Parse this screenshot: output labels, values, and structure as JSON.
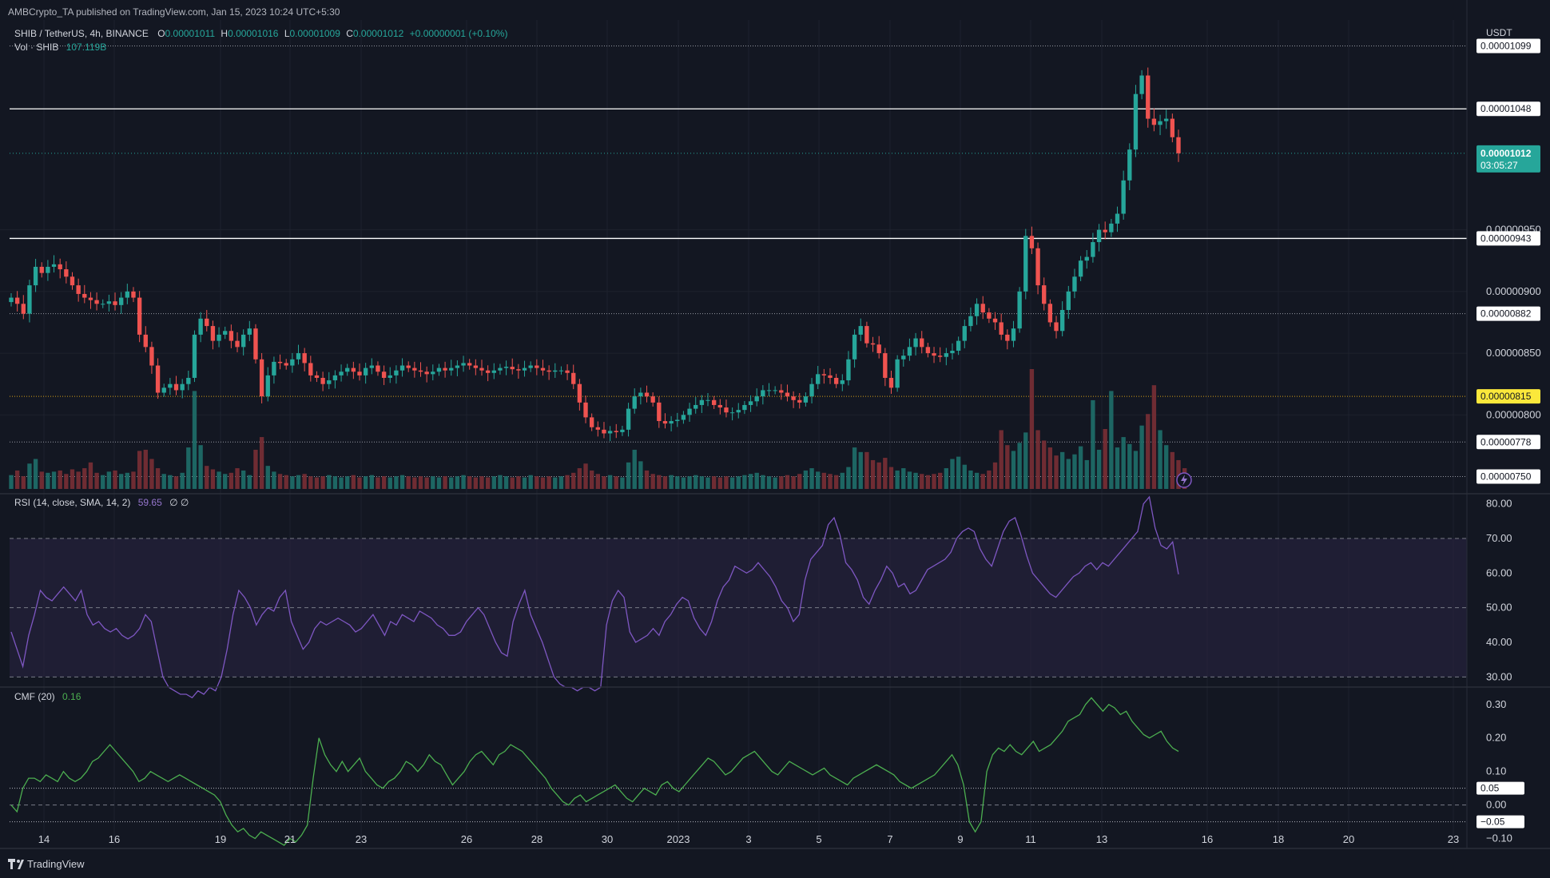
{
  "header": {
    "publisher": "AMBCrypto_TA published on TradingView.com, Jan 15, 2023 10:24 UTC+5:30"
  },
  "footer": {
    "brand": "TradingView"
  },
  "colors": {
    "background": "#131722",
    "up": "#26a69a",
    "down": "#ef5350",
    "volume_up": "#1f6f6a",
    "volume_down": "#7a2f35",
    "rsi_line": "#7e57c2",
    "rsi_band": "#2a2443",
    "cmf_line": "#4caf50",
    "price_tag": "#26a69a",
    "level_highlight": "#fbe83b"
  },
  "chart_data": [
    {
      "type": "candlestick",
      "legend": {
        "symbol": "SHIB / TetherUS, 4h, BINANCE",
        "o_label": "O",
        "o_value": "0.00001011",
        "h_label": "H",
        "h_value": "0.00001016",
        "l_label": "L",
        "l_value": "0.00001009",
        "c_label": "C",
        "c_value": "0.00001012",
        "change": "+0.00000001 (+0.10%)",
        "volume_label": "Vol · SHIB",
        "volume_value": "107.119B"
      },
      "currency": "USDT",
      "ylim": [
        7.4e-06,
        1.12e-05
      ],
      "y_ticks": [
        "0.00000950",
        "0.00000900",
        "0.00000850",
        "0.00000800"
      ],
      "y_tick_values": [
        9.5e-06,
        9e-06,
        8.5e-06,
        8e-06
      ],
      "x_ticks": [
        "14",
        "16",
        "19",
        "21",
        "23",
        "26",
        "28",
        "30",
        "2023",
        "3",
        "5",
        "7",
        "9",
        "11",
        "13",
        "16",
        "18",
        "20",
        "23"
      ],
      "levels": [
        {
          "label": "0.00001099",
          "value": 1.099e-05,
          "style": "dotted",
          "highlight": false
        },
        {
          "label": "0.00001048",
          "value": 1.048e-05,
          "style": "solid",
          "highlight": false
        },
        {
          "label": "0.00000943",
          "value": 9.43e-06,
          "style": "solid",
          "highlight": false
        },
        {
          "label": "0.00000882",
          "value": 8.82e-06,
          "style": "dotted",
          "highlight": false
        },
        {
          "label": "0.00000815",
          "value": 8.15e-06,
          "style": "dotted",
          "highlight": true
        },
        {
          "label": "0.00000778",
          "value": 7.78e-06,
          "style": "dotted",
          "highlight": false
        },
        {
          "label": "0.00000750",
          "value": 7.5e-06,
          "style": "dotted",
          "highlight": false
        }
      ],
      "current_price": {
        "label": "0.00001012",
        "countdown": "03:05:27",
        "value": 1.012e-05
      },
      "closes": [
        8.95e-06,
        8.9e-06,
        8.82e-06,
        9.05e-06,
        9.2e-06,
        9.15e-06,
        9.2e-06,
        9.22e-06,
        9.18e-06,
        9.12e-06,
        9.05e-06,
        8.98e-06,
        8.95e-06,
        8.93e-06,
        8.9e-06,
        8.9e-06,
        8.92e-06,
        8.89e-06,
        8.95e-06,
        9e-06,
        8.95e-06,
        8.65e-06,
        8.55e-06,
        8.4e-06,
        8.18e-06,
        8.22e-06,
        8.25e-06,
        8.2e-06,
        8.25e-06,
        8.3e-06,
        8.65e-06,
        8.78e-06,
        8.72e-06,
        8.6e-06,
        8.65e-06,
        8.68e-06,
        8.6e-06,
        8.55e-06,
        8.65e-06,
        8.7e-06,
        8.45e-06,
        8.15e-06,
        8.32e-06,
        8.43e-06,
        8.42e-06,
        8.4e-06,
        8.45e-06,
        8.5e-06,
        8.42e-06,
        8.32e-06,
        8.3e-06,
        8.25e-06,
        8.28e-06,
        8.32e-06,
        8.35e-06,
        8.38e-06,
        8.35e-06,
        8.32e-06,
        8.38e-06,
        8.4e-06,
        8.35e-06,
        8.3e-06,
        8.32e-06,
        8.36e-06,
        8.4e-06,
        8.38e-06,
        8.36e-06,
        8.35e-06,
        8.33e-06,
        8.35e-06,
        8.38e-06,
        8.36e-06,
        8.38e-06,
        8.4e-06,
        8.42e-06,
        8.4e-06,
        8.38e-06,
        8.36e-06,
        8.34e-06,
        8.36e-06,
        8.38e-06,
        8.39e-06,
        8.37e-06,
        8.36e-06,
        8.38e-06,
        8.4e-06,
        8.38e-06,
        8.36e-06,
        8.35e-06,
        8.36e-06,
        8.36e-06,
        8.34e-06,
        8.25e-06,
        8.1e-06,
        7.98e-06,
        7.9e-06,
        7.88e-06,
        7.85e-06,
        7.87e-06,
        7.86e-06,
        7.88e-06,
        8.05e-06,
        8.15e-06,
        8.18e-06,
        8.15e-06,
        8.1e-06,
        7.95e-06,
        7.93e-06,
        7.95e-06,
        7.96e-06,
        8e-06,
        8.05e-06,
        8.08e-06,
        8.12e-06,
        8.12e-06,
        8.08e-06,
        8.06e-06,
        8.02e-06,
        8.02e-06,
        8.04e-06,
        8.08e-06,
        8.11e-06,
        8.15e-06,
        8.2e-06,
        8.2e-06,
        8.2e-06,
        8.18e-06,
        8.15e-06,
        8.12e-06,
        8.1e-06,
        8.15e-06,
        8.25e-06,
        8.33e-06,
        8.32e-06,
        8.3e-06,
        8.25e-06,
        8.28e-06,
        8.45e-06,
        8.65e-06,
        8.72e-06,
        8.58e-06,
        8.57e-06,
        8.5e-06,
        8.3e-06,
        8.22e-06,
        8.45e-06,
        8.48e-06,
        8.55e-06,
        8.62e-06,
        8.55e-06,
        8.5e-06,
        8.48e-06,
        8.47e-06,
        8.5e-06,
        8.52e-06,
        8.6e-06,
        8.72e-06,
        8.8e-06,
        8.9e-06,
        8.83e-06,
        8.78e-06,
        8.75e-06,
        8.65e-06,
        8.6e-06,
        8.7e-06,
        9e-06,
        9.45e-06,
        9.35e-06,
        9.05e-06,
        8.9e-06,
        8.75e-06,
        8.68e-06,
        8.85e-06,
        9e-06,
        9.12e-06,
        9.25e-06,
        9.28e-06,
        9.4e-06,
        9.5e-06,
        9.48e-06,
        9.55e-06,
        9.63e-06,
        9.9e-06,
        1.015e-05,
        1.06e-05,
        1.075e-05,
        1.04e-05,
        1.035e-05,
        1.038e-05,
        1.04e-05,
        1.025e-05,
        1.012e-05
      ],
      "vol_values": [
        1.2,
        1.6,
        1.1,
        2.2,
        2.6,
        1.5,
        1.4,
        1.5,
        1.6,
        1.3,
        1.7,
        1.5,
        1.8,
        2.3,
        1.4,
        1.2,
        1.5,
        1.6,
        1.3,
        1.4,
        1.5,
        3.3,
        3.4,
        2.6,
        1.8,
        1.3,
        1.2,
        1.1,
        1.4,
        3.6,
        8.5,
        3.8,
        2.0,
        1.7,
        1.5,
        1.3,
        1.4,
        1.8,
        1.6,
        1.2,
        3.4,
        4.5,
        2.0,
        1.5,
        1.3,
        1.2,
        1.1,
        1.2,
        1.3,
        1.1,
        1.0,
        1.1,
        1.2,
        1.1,
        1.0,
        1.1,
        1.2,
        1.0,
        1.1,
        1.2,
        1.0,
        1.1,
        1.0,
        1.1,
        1.2,
        1.1,
        1.0,
        1.1,
        1.0,
        1.1,
        1.0,
        1.1,
        1.0,
        1.1,
        1.2,
        1.1,
        1.0,
        1.1,
        1.0,
        1.1,
        1.2,
        1.1,
        1.0,
        1.1,
        1.0,
        1.2,
        1.1,
        1.0,
        1.1,
        1.0,
        1.1,
        1.2,
        1.4,
        1.8,
        2.2,
        1.6,
        1.3,
        1.1,
        1.2,
        1.1,
        1.0,
        2.3,
        3.4,
        2.4,
        1.6,
        1.3,
        1.2,
        1.1,
        1.2,
        1.1,
        1.0,
        1.1,
        1.2,
        1.1,
        1.0,
        1.1,
        1.0,
        1.1,
        1.0,
        1.1,
        1.2,
        1.3,
        1.4,
        1.2,
        1.1,
        1.0,
        1.1,
        1.2,
        1.1,
        1.3,
        1.6,
        1.8,
        1.5,
        1.4,
        1.3,
        1.2,
        1.4,
        1.9,
        3.6,
        3.2,
        3.2,
        2.5,
        2.3,
        2.7,
        1.9,
        1.6,
        1.8,
        1.5,
        1.4,
        1.3,
        1.2,
        1.3,
        1.4,
        1.8,
        2.6,
        2.8,
        2.1,
        1.6,
        1.4,
        1.3,
        1.6,
        2.3,
        5.1,
        3.8,
        3.3,
        4.0,
        4.9,
        10.4,
        5.1,
        4.2,
        3.6,
        2.9,
        3.2,
        2.6,
        3.0,
        3.7,
        2.5,
        7.7,
        3.4,
        5.2,
        8.5,
        3.6,
        4.5,
        3.9,
        3.3,
        5.5,
        6.5,
        9.0,
        5.1,
        3.8,
        3.2,
        2.5,
        1.8
      ]
    },
    {
      "type": "line",
      "legend": {
        "name": "RSI (14, close, SMA, 14, 2)",
        "value": "59.65",
        "extra": "∅ ∅"
      },
      "ylim": [
        28,
        82
      ],
      "y_ticks": [
        "80.00",
        "70.00",
        "60.00",
        "50.00",
        "40.00",
        "30.00"
      ],
      "y_tick_values": [
        80,
        70,
        60,
        50,
        40,
        30
      ],
      "band": [
        30,
        70
      ],
      "midline": 50,
      "values": [
        43,
        38,
        33,
        42,
        48,
        55,
        53,
        52,
        54,
        56,
        54,
        52,
        55,
        48,
        45,
        46,
        44,
        43,
        44,
        42,
        41,
        42,
        44,
        48,
        46,
        38,
        30,
        27,
        26,
        25,
        25,
        24,
        26,
        25,
        27,
        26,
        30,
        38,
        48,
        55,
        53,
        50,
        45,
        48,
        50,
        49,
        53,
        55,
        46,
        42,
        38,
        40,
        44,
        46,
        45,
        46,
        47,
        46,
        45,
        43,
        44,
        46,
        48,
        45,
        42,
        46,
        45,
        48,
        47,
        46,
        49,
        48,
        47,
        45,
        44,
        42,
        42,
        43,
        46,
        48,
        50,
        48,
        44,
        40,
        37,
        36,
        46,
        51,
        55,
        48,
        44,
        40,
        35,
        30,
        28,
        27,
        27,
        26,
        27,
        27,
        26,
        27,
        45,
        52,
        55,
        53,
        43,
        40,
        41,
        42,
        44,
        42,
        46,
        48,
        51,
        53,
        52,
        47,
        44,
        42,
        46,
        52,
        56,
        58,
        62,
        61,
        60,
        61,
        63,
        61,
        59,
        56,
        52,
        50,
        46,
        48,
        58,
        64,
        66,
        68,
        74,
        76,
        71,
        63,
        61,
        58,
        53,
        51,
        55,
        58,
        62,
        60,
        56,
        57,
        54,
        55,
        58,
        61,
        62,
        63,
        64,
        66,
        70,
        72,
        73,
        72,
        67,
        64,
        62,
        67,
        72,
        75,
        76,
        71,
        65,
        60,
        58,
        56,
        54,
        53,
        55,
        57,
        59,
        60,
        62,
        63,
        61,
        63,
        62,
        64,
        66,
        68,
        70,
        72,
        80,
        82,
        73,
        68,
        67,
        69,
        59.65
      ],
      "x_ticks": []
    },
    {
      "type": "line",
      "legend": {
        "name": "CMF (20)",
        "value": "0.16"
      },
      "ylim": [
        -0.12,
        0.34
      ],
      "y_ticks": [
        "0.30",
        "0.20",
        "0.10",
        "0.00",
        "−0.10"
      ],
      "y_tick_values": [
        0.3,
        0.2,
        0.1,
        0.0,
        -0.1
      ],
      "levels": [
        {
          "label": "0.05",
          "value": 0.05
        },
        {
          "label": "−0.05",
          "value": -0.05
        }
      ],
      "zero_line": 0,
      "values": [
        0.0,
        -0.02,
        0.05,
        0.08,
        0.08,
        0.07,
        0.09,
        0.08,
        0.07,
        0.1,
        0.08,
        0.07,
        0.08,
        0.1,
        0.13,
        0.14,
        0.16,
        0.18,
        0.16,
        0.14,
        0.12,
        0.1,
        0.07,
        0.08,
        0.1,
        0.09,
        0.08,
        0.07,
        0.08,
        0.09,
        0.08,
        0.07,
        0.06,
        0.05,
        0.04,
        0.03,
        0.01,
        -0.03,
        -0.06,
        -0.08,
        -0.07,
        -0.09,
        -0.1,
        -0.08,
        -0.09,
        -0.1,
        -0.11,
        -0.12,
        -0.1,
        -0.11,
        -0.09,
        -0.06,
        0.08,
        0.2,
        0.15,
        0.12,
        0.1,
        0.13,
        0.1,
        0.12,
        0.14,
        0.1,
        0.08,
        0.06,
        0.05,
        0.07,
        0.08,
        0.1,
        0.13,
        0.12,
        0.1,
        0.12,
        0.15,
        0.13,
        0.12,
        0.09,
        0.06,
        0.08,
        0.1,
        0.13,
        0.15,
        0.16,
        0.14,
        0.12,
        0.15,
        0.16,
        0.18,
        0.17,
        0.16,
        0.14,
        0.12,
        0.1,
        0.08,
        0.05,
        0.03,
        0.01,
        0.0,
        0.02,
        0.03,
        0.01,
        0.02,
        0.03,
        0.04,
        0.05,
        0.06,
        0.04,
        0.02,
        0.01,
        0.03,
        0.05,
        0.04,
        0.03,
        0.06,
        0.07,
        0.05,
        0.04,
        0.06,
        0.08,
        0.1,
        0.12,
        0.14,
        0.13,
        0.11,
        0.09,
        0.1,
        0.12,
        0.14,
        0.15,
        0.16,
        0.14,
        0.12,
        0.1,
        0.09,
        0.11,
        0.13,
        0.12,
        0.11,
        0.1,
        0.09,
        0.1,
        0.11,
        0.09,
        0.08,
        0.07,
        0.06,
        0.08,
        0.09,
        0.1,
        0.11,
        0.12,
        0.11,
        0.1,
        0.09,
        0.07,
        0.06,
        0.05,
        0.06,
        0.07,
        0.08,
        0.09,
        0.11,
        0.13,
        0.15,
        0.12,
        0.06,
        -0.05,
        -0.08,
        -0.05,
        0.1,
        0.15,
        0.17,
        0.16,
        0.18,
        0.16,
        0.15,
        0.17,
        0.19,
        0.16,
        0.17,
        0.18,
        0.2,
        0.22,
        0.25,
        0.26,
        0.27,
        0.3,
        0.32,
        0.3,
        0.28,
        0.3,
        0.29,
        0.27,
        0.28,
        0.25,
        0.23,
        0.21,
        0.2,
        0.21,
        0.22,
        0.19,
        0.17,
        0.16
      ],
      "x_ticks": []
    }
  ]
}
